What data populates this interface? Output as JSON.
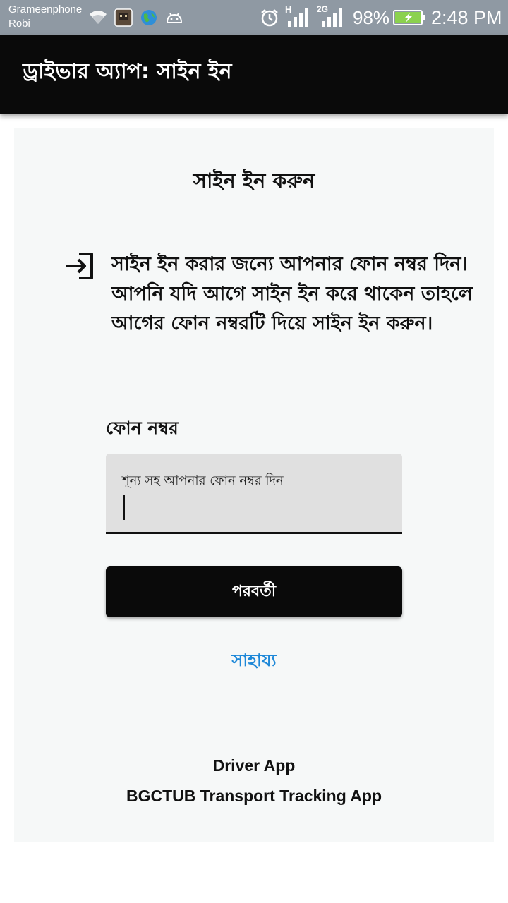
{
  "status_bar": {
    "carrier_1": "Grameenphone",
    "carrier_2": "Robi",
    "network_1": "H",
    "network_2": "2G",
    "battery": "98%",
    "time": "2:48 PM",
    "icons": [
      "wifi-icon",
      "app-notification-icon",
      "globe-icon",
      "android-icon",
      "alarm-icon",
      "signal-icon",
      "signal-icon",
      "battery-charging-icon"
    ]
  },
  "app_bar": {
    "title": "ড্রাইভার অ্যাপ: সাইন ইন"
  },
  "sign_in": {
    "heading": "সাইন ইন করুন",
    "icon": "login-icon",
    "instructions": "সাইন ইন করার জন্যে আপনার ফোন নম্বর দিন। আপনি যদি আগে সাইন ইন করে থাকেন তাহলে আগের ফোন নম্বরটি দিয়ে সাইন ইন করুন।",
    "phone_label": "ফোন নম্বর",
    "phone_placeholder": "শূন্য সহ আপনার ফোন নম্বর দিন",
    "phone_value": "",
    "next_button": "পরবর্তী",
    "help_link": "সাহায্য"
  },
  "footer": {
    "app_name": "Driver App",
    "app_full_name": "BGCTUB Transport Tracking App"
  },
  "colors": {
    "status_bar": "#8f99a3",
    "app_bar": "#0a0a0a",
    "card": "#f6f8f8",
    "input_bg": "#e0e0e0",
    "link": "#1e88d8",
    "battery_fill": "#8bd14e"
  }
}
